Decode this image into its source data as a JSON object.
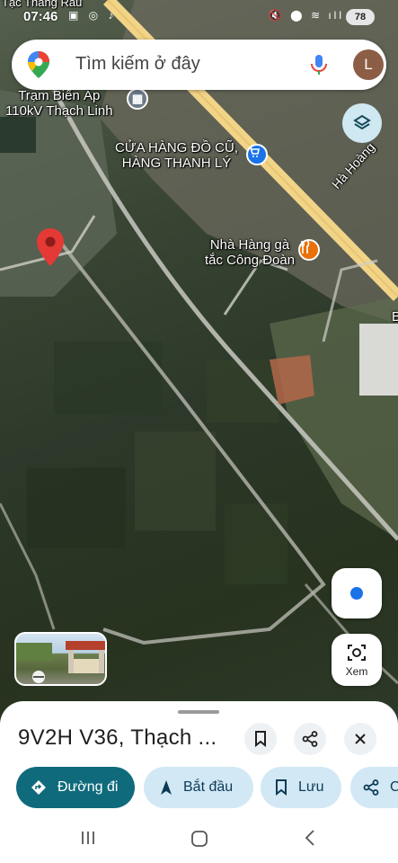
{
  "status_bar": {
    "time": "07:46",
    "left_icons": "▣ ◎ ♪",
    "right_icons": "🔇 ⬤ ≋ ıll",
    "battery": "78"
  },
  "search": {
    "placeholder": "Tìm kiếm ở đây",
    "avatar_initial": "L"
  },
  "map": {
    "labels": {
      "top_partial": "Tạc Thắng Rau",
      "substation_line1": "Trạm Biến Áp",
      "substation_line2": "110kV Thạch Linh",
      "store_line1": "CỬA HÀNG ĐỒ CŨ,",
      "store_line2": "HÀNG THANH LÝ",
      "restaurant_line1": "Nhà Hàng gà",
      "restaurant_line2": "tắc Công Đoàn",
      "road": "Hà Hoàng",
      "edge_letter": "B"
    }
  },
  "controls": {
    "xem_label": "Xem"
  },
  "sheet": {
    "title": "9V2H V36, Thạch ...",
    "actions": {
      "directions": "Đường đi",
      "start": "Bắt đầu",
      "save": "Lưu",
      "share_partial": "C"
    }
  },
  "colors": {
    "primary_chip": "#0f6b7c",
    "secondary_chip": "#d2e8f5",
    "pin": "#e53935",
    "road_highlight": "#f2d488",
    "location_dot": "#1a73e8"
  }
}
